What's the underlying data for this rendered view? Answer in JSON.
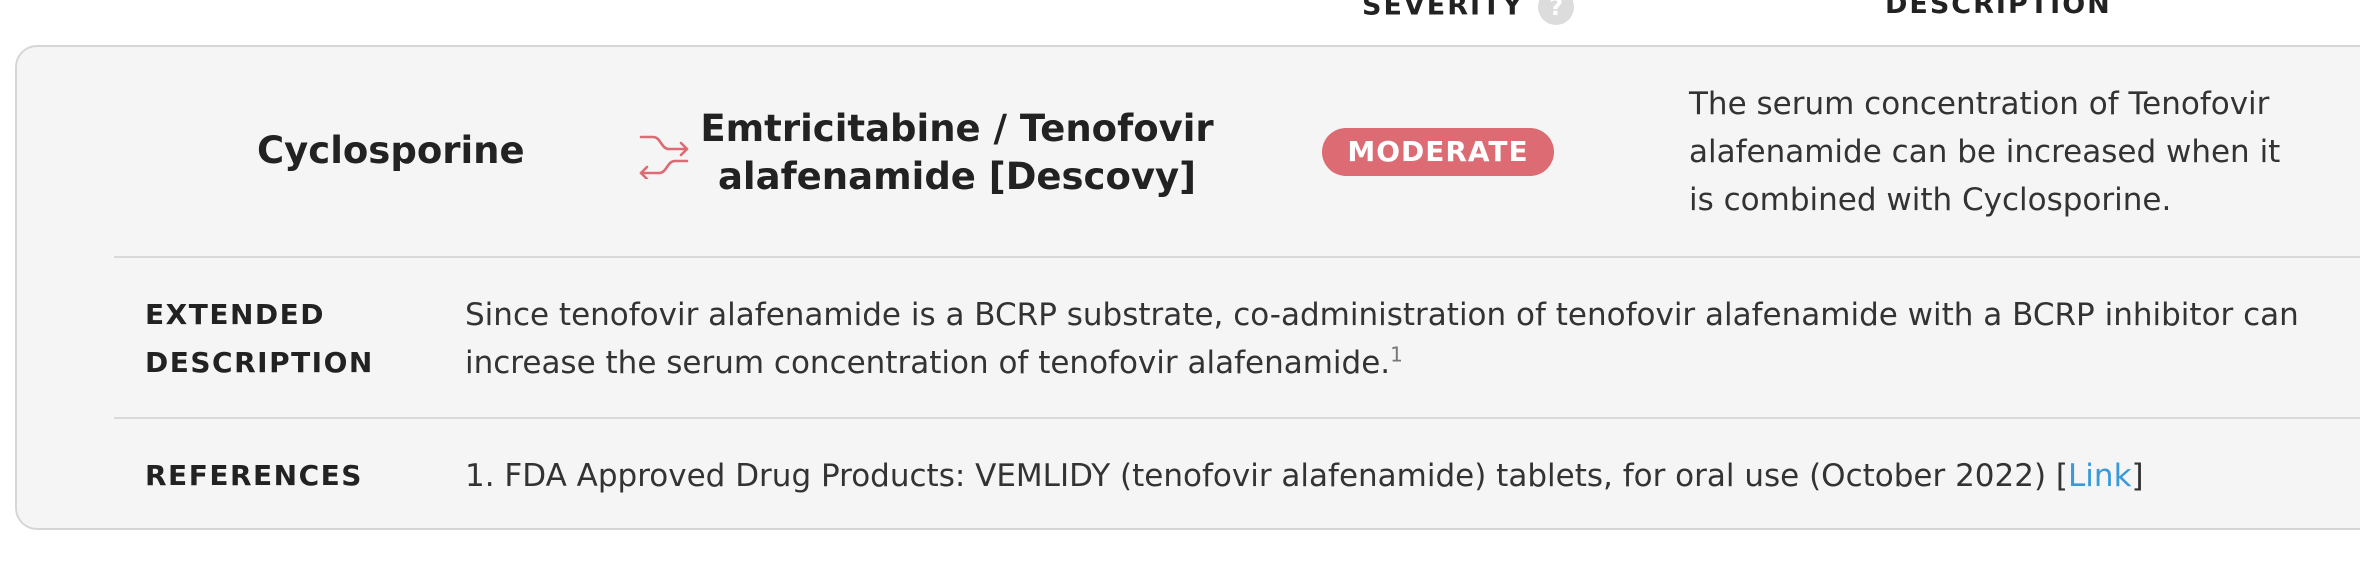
{
  "header": {
    "severity_label": "SEVERITY",
    "help_glyph": "?",
    "description_label": "DESCRIPTION"
  },
  "interaction": {
    "drug_a": "Cyclosporine",
    "drug_b": "Emtricitabine / Tenofovir alafenamide [Descovy]",
    "severity": "MODERATE",
    "severity_color": "#dd6b73",
    "description": "The serum concentration of Tenofovir alafenamide can be increased when it is combined with Cyclosporine.",
    "icon": "swap-arrows-icon"
  },
  "extended": {
    "label": "EXTENDED DESCRIPTION",
    "line1": "Since tenofovir alafenamide is a BCRP substrate, co-administration of tenofovir alafenamide with a BCRP inhibitor can",
    "line2": "increase the serum concentration of tenofovir alafenamide.",
    "footnote": "1"
  },
  "references": {
    "label": "REFERENCES",
    "item1_text": "1. FDA Approved Drug Products: VEMLIDY (tenofovir alafenamide) tablets, for oral use (October 2022) [",
    "item1_link": "Link",
    "item1_close": "]",
    "link_color": "#3a9ad9"
  }
}
